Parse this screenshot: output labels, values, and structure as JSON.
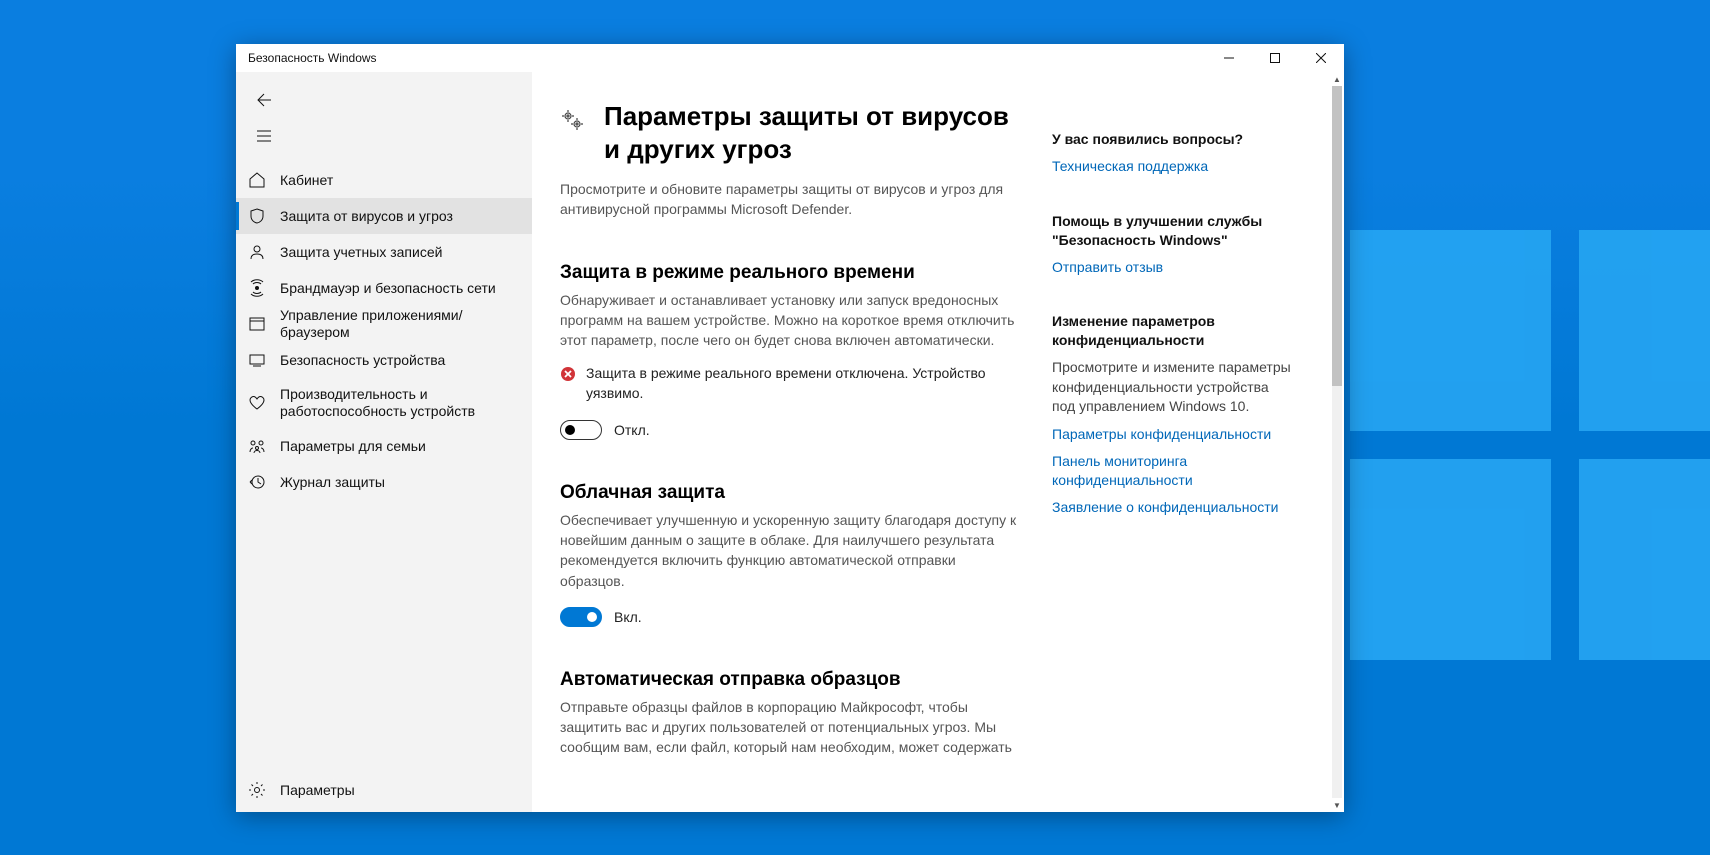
{
  "window": {
    "title": "Безопасность Windows"
  },
  "sidebar": {
    "items": [
      {
        "label": "Кабинет"
      },
      {
        "label": "Защита от вирусов и угроз"
      },
      {
        "label": "Защита учетных записей"
      },
      {
        "label": "Брандмауэр и безопасность сети"
      },
      {
        "label": "Управление приложениями/браузером"
      },
      {
        "label": "Безопасность устройства"
      },
      {
        "label": "Производительность и работоспособность устройств"
      },
      {
        "label": "Параметры для семьи"
      },
      {
        "label": "Журнал защиты"
      }
    ],
    "footer": {
      "label": "Параметры"
    }
  },
  "page": {
    "title": "Параметры защиты от вирусов и других угроз",
    "subtitle": "Просмотрите и обновите параметры защиты от вирусов и угроз для антивирусной программы Microsoft Defender."
  },
  "sections": {
    "realtime": {
      "title": "Защита в режиме реального времени",
      "desc": "Обнаруживает и останавливает установку или запуск вредоносных программ на вашем устройстве. Можно на короткое время отключить этот параметр, после чего он будет снова включен автоматически.",
      "warning": "Защита в режиме реального времени отключена. Устройство уязвимо.",
      "toggle_label": "Откл."
    },
    "cloud": {
      "title": "Облачная защита",
      "desc": "Обеспечивает улучшенную и ускоренную защиту благодаря доступу к новейшим данным о защите в облаке. Для наилучшего результата рекомендуется включить функцию автоматической отправки образцов.",
      "toggle_label": "Вкл."
    },
    "samples": {
      "title": "Автоматическая отправка образцов",
      "desc": "Отправьте образцы файлов в корпорацию Майкрософт, чтобы защитить вас и других пользователей от потенциальных угроз. Мы сообщим вам, если файл, который нам необходим, может содержать"
    }
  },
  "aside": {
    "q_title": "У вас появились вопросы?",
    "q_link": "Техническая поддержка",
    "fb_title": "Помощь в улучшении службы \"Безопасность Windows\"",
    "fb_link": "Отправить отзыв",
    "priv_title": "Изменение параметров конфиденциальности",
    "priv_para": "Просмотрите и измените параметры конфиденциальности устройства под управлением Windows 10.",
    "priv_link1": "Параметры конфиденциальности",
    "priv_link2": "Панель мониторинга конфиденциальности",
    "priv_link3": "Заявление о конфиденциальности"
  }
}
